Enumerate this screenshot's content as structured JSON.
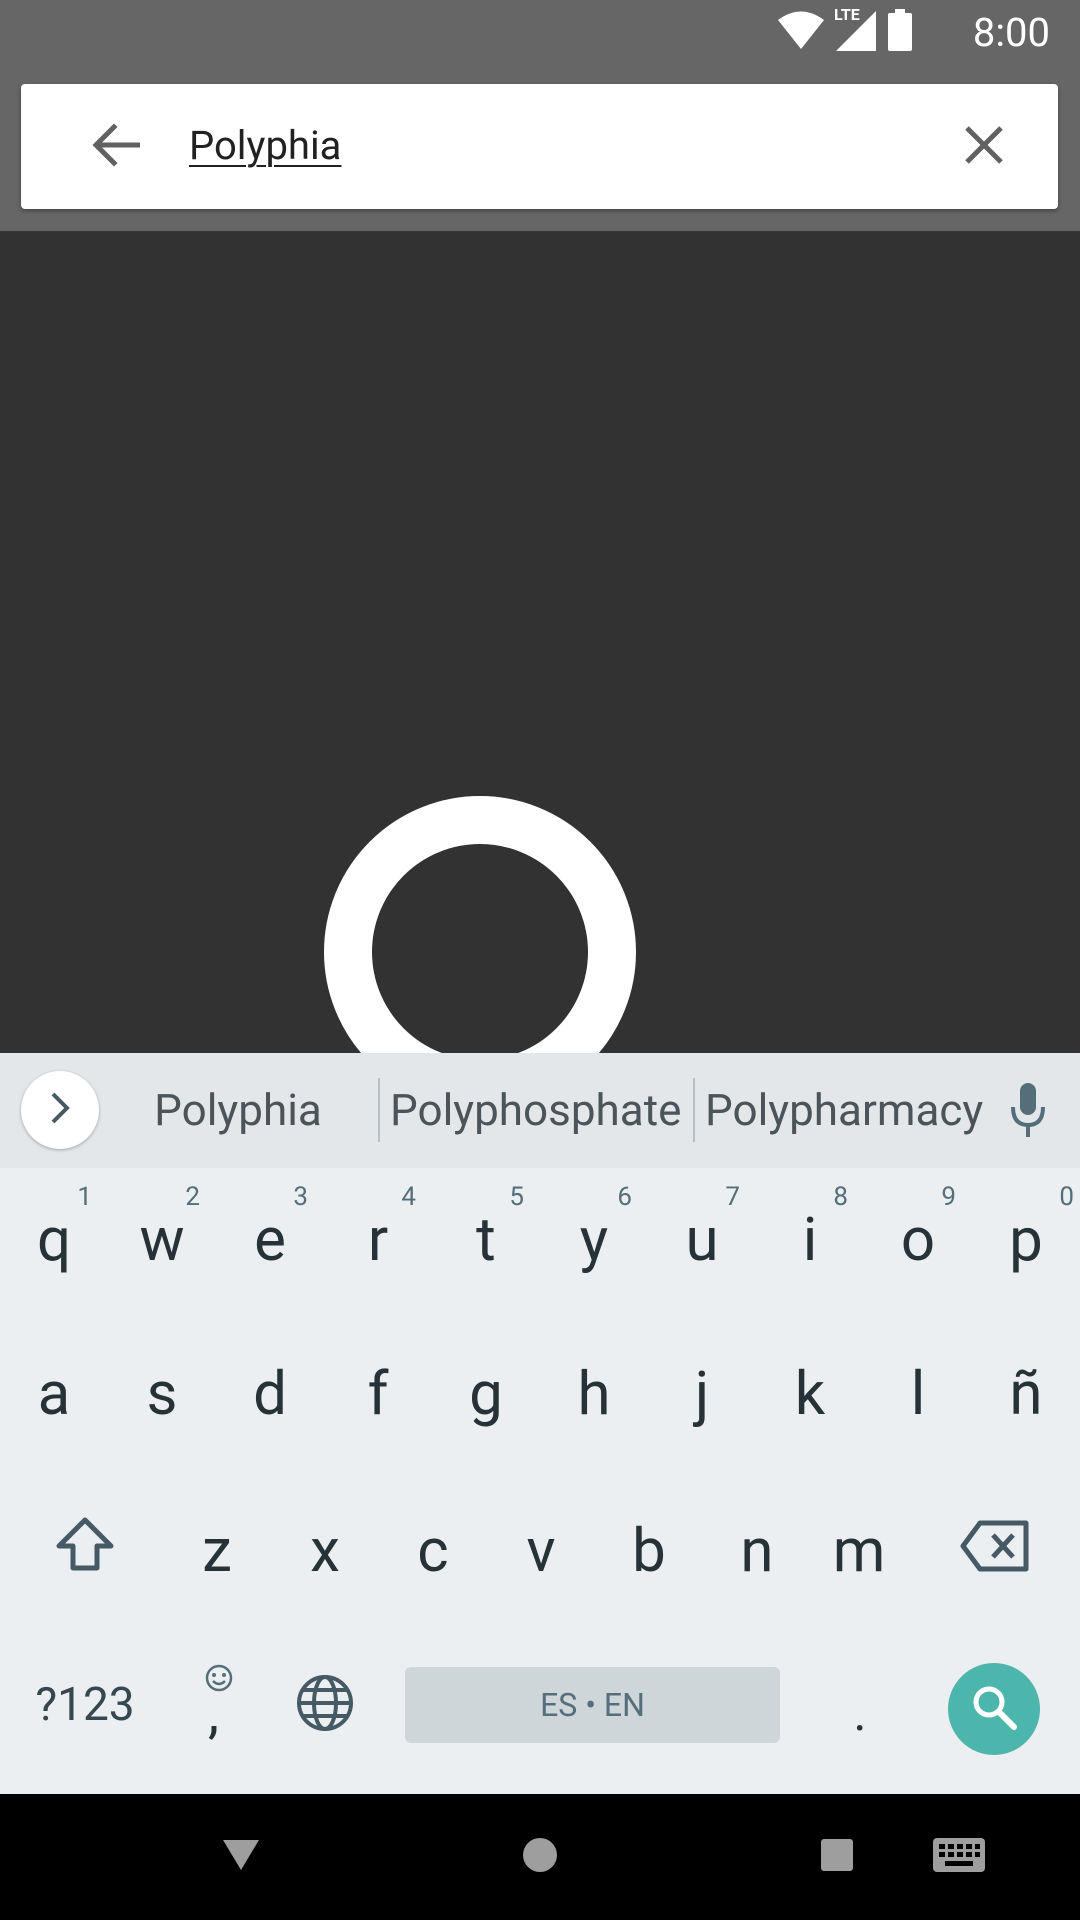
{
  "status_bar": {
    "time": "8:00",
    "network_label": "LTE"
  },
  "search": {
    "query": "Polyphia",
    "back_label": "back",
    "clear_label": "clear"
  },
  "keyboard": {
    "suggestions": [
      "Polyphia",
      "Polyphosphate",
      "Polypharmacy"
    ],
    "row1": [
      {
        "letter": "q",
        "hint": "1"
      },
      {
        "letter": "w",
        "hint": "2"
      },
      {
        "letter": "e",
        "hint": "3"
      },
      {
        "letter": "r",
        "hint": "4"
      },
      {
        "letter": "t",
        "hint": "5"
      },
      {
        "letter": "y",
        "hint": "6"
      },
      {
        "letter": "u",
        "hint": "7"
      },
      {
        "letter": "i",
        "hint": "8"
      },
      {
        "letter": "o",
        "hint": "9"
      },
      {
        "letter": "p",
        "hint": "0"
      }
    ],
    "row2": [
      "a",
      "s",
      "d",
      "f",
      "g",
      "h",
      "j",
      "k",
      "l",
      "ñ"
    ],
    "row3": [
      "z",
      "x",
      "c",
      "v",
      "b",
      "n",
      "m"
    ],
    "symbols_label": "?123",
    "comma_label": ",",
    "space_label": "ES • EN",
    "period_label": "."
  },
  "colors": {
    "accent": "#4DB6AC",
    "keyboard_bg": "#ECEFF1",
    "header_bg": "#666666",
    "content_bg": "#323232"
  },
  "icons": [
    "wifi-icon",
    "signal-icon",
    "battery-icon",
    "arrow-back-icon",
    "close-icon",
    "chevron-right-icon",
    "mic-icon",
    "shift-icon",
    "backspace-icon",
    "emoji-icon",
    "globe-icon",
    "search-icon",
    "nav-back-icon",
    "nav-home-icon",
    "nav-recents-icon",
    "keyboard-switch-icon"
  ]
}
